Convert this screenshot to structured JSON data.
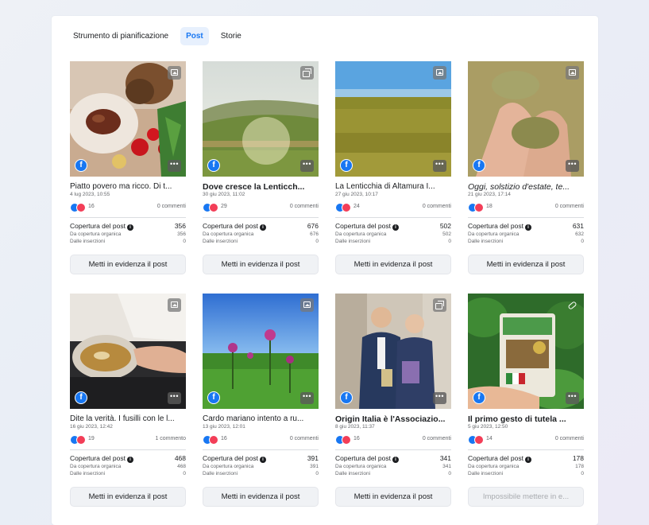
{
  "tabs": [
    {
      "label": "Strumento di pianificazione",
      "active": false
    },
    {
      "label": "Post",
      "active": true
    },
    {
      "label": "Storie",
      "active": false
    }
  ],
  "metric_labels": {
    "reach": "Copertura del post",
    "organic": "Da copertura organica",
    "ads": "Dalle inserzioni"
  },
  "posts": [
    {
      "title": "Piatto povero ma ricco. Di t...",
      "date": "4 lug 2023, 10:55",
      "reactions": "16",
      "comments": "0 commenti",
      "reach": "356",
      "organic": "356",
      "ads": "0",
      "button": "Metti in evidenza il post",
      "button_disabled": false,
      "media_icon": "image-icon",
      "title_style": "normal"
    },
    {
      "title": "Dove cresce la Lenticch...",
      "date": "30 giu 2023, 11:02",
      "reactions": "29",
      "comments": "0 commenti",
      "reach": "676",
      "organic": "676",
      "ads": "0",
      "button": "Metti in evidenza il post",
      "button_disabled": false,
      "media_icon": "album-icon",
      "title_style": "bold"
    },
    {
      "title": "La Lenticchia di Altamura I...",
      "date": "27 giu 2023, 10:17",
      "reactions": "24",
      "comments": "0 commenti",
      "reach": "502",
      "organic": "502",
      "ads": "0",
      "button": "Metti in evidenza il post",
      "button_disabled": false,
      "media_icon": "image-icon",
      "title_style": "normal"
    },
    {
      "title": "Oggi, solstizio d'estate, te...",
      "date": "21 giu 2023, 17:14",
      "reactions": "18",
      "comments": "0 commenti",
      "reach": "631",
      "organic": "632",
      "ads": "0",
      "button": "Metti in evidenza il post",
      "button_disabled": false,
      "media_icon": "image-icon",
      "title_style": "italic"
    },
    {
      "title": "Dite la verità. I fusilli con le l...",
      "date": "16 giu 2023, 12:42",
      "reactions": "19",
      "comments": "1 commento",
      "reach": "468",
      "organic": "468",
      "ads": "0",
      "button": "Metti in evidenza il post",
      "button_disabled": false,
      "media_icon": "image-icon",
      "title_style": "normal"
    },
    {
      "title": "Cardo mariano intento a ru...",
      "date": "13 giu 2023, 12:01",
      "reactions": "16",
      "comments": "0 commenti",
      "reach": "391",
      "organic": "391",
      "ads": "0",
      "button": "Metti in evidenza il post",
      "button_disabled": false,
      "media_icon": "image-icon",
      "title_style": "normal"
    },
    {
      "title": "Origin Italia è l'Associazio...",
      "date": "8 giu 2023, 11:37",
      "reactions": "16",
      "comments": "0 commenti",
      "reach": "341",
      "organic": "341",
      "ads": "0",
      "button": "Metti in evidenza il post",
      "button_disabled": false,
      "media_icon": "album-icon",
      "title_style": "bold"
    },
    {
      "title": "Il primo gesto di tutela ...",
      "date": "5 giu 2023, 12:50",
      "reactions": "14",
      "comments": "0 commenti",
      "reach": "178",
      "organic": "178",
      "ads": "0",
      "button": "Impossibile mettere in e...",
      "button_disabled": true,
      "media_icon": "link-icon",
      "title_style": "bold"
    }
  ]
}
